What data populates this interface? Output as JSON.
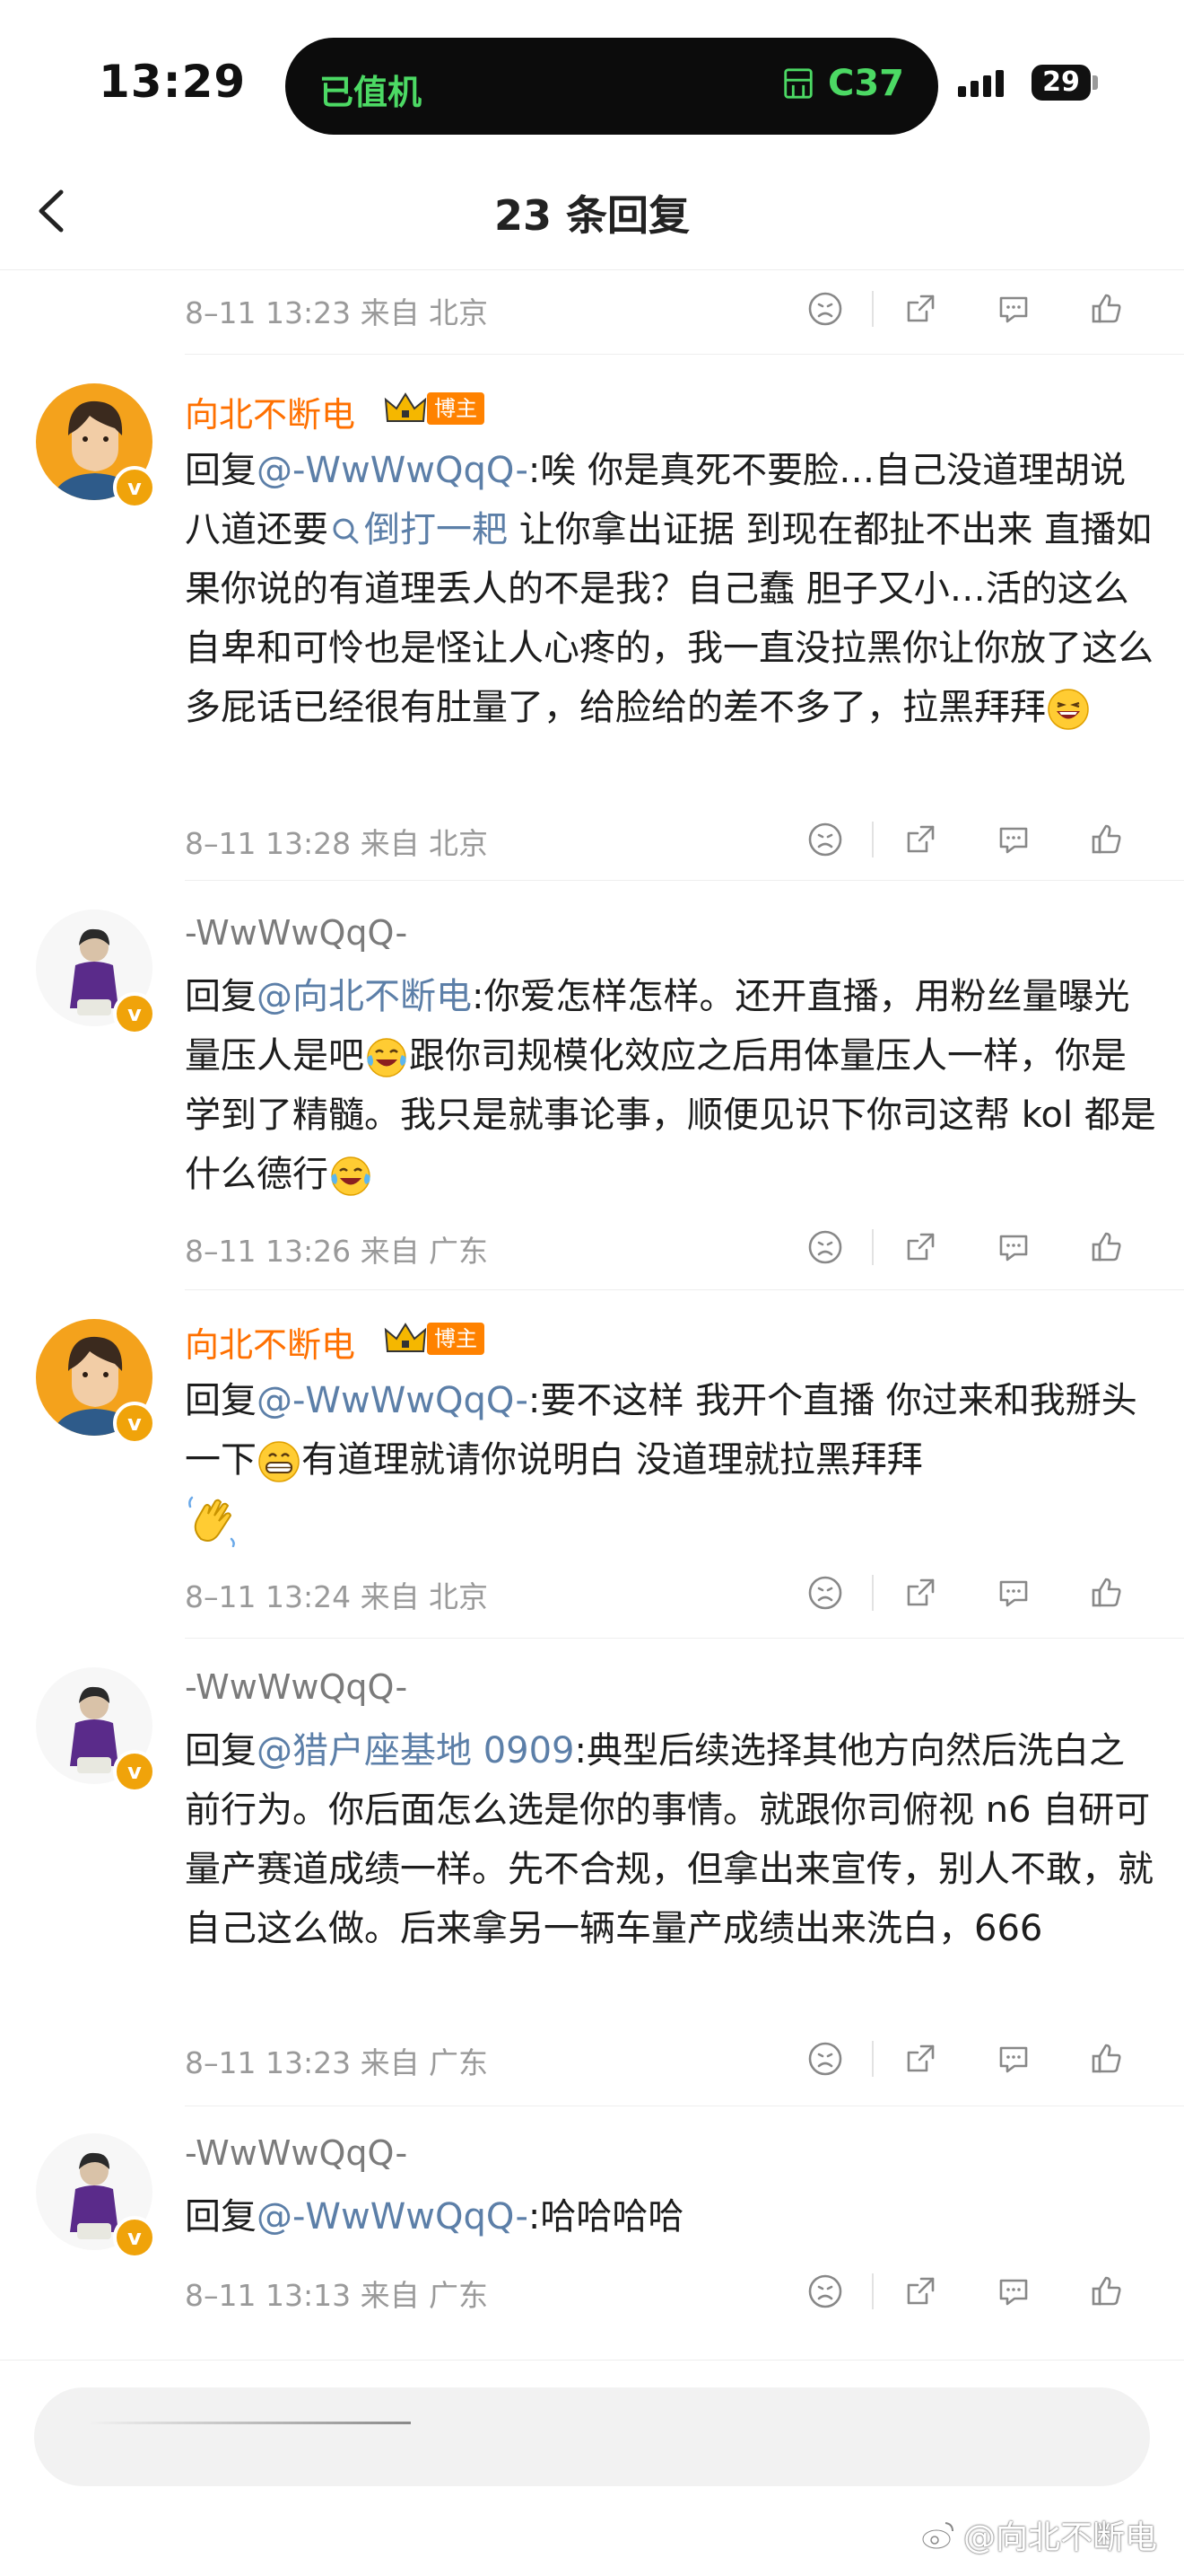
{
  "status": {
    "time": "13:29",
    "island_left": "已值机",
    "island_right": "C37",
    "battery": "29"
  },
  "header": {
    "title": "23 条回复"
  },
  "top_meta": {
    "time": "8–11 13:23 来自 北京"
  },
  "comments": [
    {
      "name": "向北不断电",
      "tag": "博主",
      "prefix": "回复",
      "mention": "@-WwWwQqQ-",
      "text_a": ":唉 你是真死不要脸…自己没道理胡说八道还要",
      "link": "倒打一耙",
      "text_b": " 让你拿出证据 到现在都扯不出来 直播如果你说的有道理丢人的不是我？自己蠢 胆子又小…活的这么自卑和可怜也是怪让人心疼的，我一直没拉黑你让你放了这么多屁话已经很有肚量了，给脸给的差不多了，拉黑拜拜",
      "meta": "8–11 13:28 来自 北京"
    },
    {
      "name": "-WwWwQqQ-",
      "prefix": "回复",
      "mention": "@向北不断电",
      "text_a": ":你爱怎样怎样。还开直播，用粉丝量曝光量压人是吧",
      "text_b": "跟你司规模化效应之后用体量压人一样，你是学到了精髓。我只是就事论事，顺便见识下你司这帮 kol 都是什么德行",
      "meta": "8–11 13:26 来自 广东"
    },
    {
      "name": "向北不断电",
      "tag": "博主",
      "prefix": "回复",
      "mention": "@-WwWwQqQ-",
      "text_a": ":要不这样 我开个直播 你过来和我掰头一下",
      "text_b": "有道理就请你说明白 没道理就拉黑拜拜",
      "meta": "8–11 13:24 来自 北京"
    },
    {
      "name": "-WwWwQqQ-",
      "prefix": "回复",
      "mention": "@猎户座基地 0909",
      "text_a": ":典型后续选择其他方向然后洗白之前行为。你后面怎么选是你的事情。就跟你司俯视 n6 自研可量产赛道成绩一样。先不合规，但拿出来宣传，别人不敢，就自己这么做。后来拿另一辆车量产成绩出来洗白，666",
      "meta": "8–11 13:23 来自 广东"
    },
    {
      "name": "-WwWwQqQ-",
      "prefix": "回复",
      "mention": "@-WwWwQqQ-",
      "text_a": ":哈哈哈哈",
      "meta": "8–11 13:13 来自 广东"
    }
  ],
  "watermark": "@向北不断电",
  "icons": [
    "back-arrow-icon",
    "dislike-face-icon",
    "share-icon",
    "comment-icon",
    "like-icon",
    "search-icon",
    "crown-icon",
    "verified-icon"
  ],
  "colors": {
    "blogger_name": "#ff7000",
    "mention": "#5c7fa8",
    "meta": "#9a9a9a",
    "island_text": "#4cd964"
  }
}
